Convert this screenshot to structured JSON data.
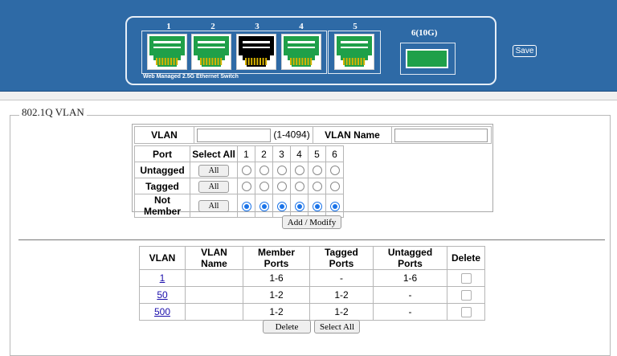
{
  "header": {
    "ports": [
      {
        "number": "1",
        "state": "link-up"
      },
      {
        "number": "2",
        "state": "link-up"
      },
      {
        "number": "3",
        "state": "link-down"
      },
      {
        "number": "4",
        "state": "link-up"
      },
      {
        "number": "5",
        "state": "link-up"
      }
    ],
    "switch_label": "Web Managed 2.5G Ethernet Switch",
    "port10g_label": "6(10G)",
    "save_label": "Save",
    "colors": {
      "header_bg": "#2e6aa6",
      "port_up": "#1fa049",
      "port_down": "#000000"
    }
  },
  "section": {
    "legend": "802.1Q VLAN"
  },
  "form": {
    "vlan_label": "VLAN",
    "vlan_value": "",
    "vlan_range": "(1-4094)",
    "vlan_name_label": "VLAN Name",
    "vlan_name_value": "",
    "port_header": "Port",
    "select_all_header": "Select All",
    "port_numbers": [
      "1",
      "2",
      "3",
      "4",
      "5",
      "6"
    ],
    "rows": [
      {
        "label": "Untagged",
        "button": "All",
        "selected": [
          false,
          false,
          false,
          false,
          false,
          false
        ]
      },
      {
        "label": "Tagged",
        "button": "All",
        "selected": [
          false,
          false,
          false,
          false,
          false,
          false
        ]
      },
      {
        "label": "Not Member",
        "button": "All",
        "selected": [
          true,
          true,
          true,
          true,
          true,
          true
        ]
      }
    ],
    "add_modify_label": "Add / Modify"
  },
  "vlan_list": {
    "headers": [
      "VLAN",
      "VLAN Name",
      "Member Ports",
      "Tagged Ports",
      "Untagged Ports",
      "Delete"
    ],
    "rows": [
      {
        "vlan": "1",
        "name": "",
        "member": "1-6",
        "tagged": "-",
        "untagged": "1-6"
      },
      {
        "vlan": "50",
        "name": "",
        "member": "1-2",
        "tagged": "1-2",
        "untagged": "-"
      },
      {
        "vlan": "500",
        "name": "",
        "member": "1-2",
        "tagged": "1-2",
        "untagged": "-"
      }
    ],
    "delete_label": "Delete",
    "select_all_label": "Select All"
  }
}
